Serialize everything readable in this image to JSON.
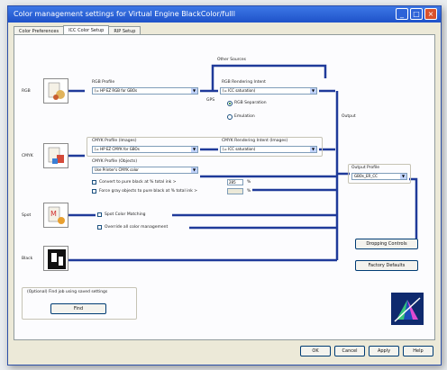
{
  "window": {
    "title": "Color management settings for Virtual Engine BlackColor/fulll",
    "buttons": {
      "minimize": "_",
      "maximize": "□",
      "close": "×"
    }
  },
  "tabs": [
    {
      "label": "Color Preferences"
    },
    {
      "label": "ICC Color Setup"
    },
    {
      "label": "RIP Setup"
    }
  ],
  "sections": {
    "rgb": {
      "label": "RGB"
    },
    "cmyk": {
      "label": "CMYK"
    },
    "spot": {
      "label": "Spot"
    },
    "black": {
      "label": "Black"
    }
  },
  "rgb": {
    "profile_label": "RGB Profile",
    "profile_value": "(= HP EZ RGB for GBOs",
    "other_sources_label": "Other Sources",
    "rendering_intent_label": "RGB Rendering Intent",
    "rendering_intent_value": "(= ICC saturation)",
    "separation_label": "RGB Separation",
    "emulation_label": "Emulation",
    "gps_label": "GPS"
  },
  "cmyk": {
    "profile_images_label": "CMYK Profile (Images)",
    "profile_images_value": "(= HP EZ CMYK for GBOs",
    "rendering_intent_images_label": "CMYK Rendering Intent (Images)",
    "rendering_intent_images_value": "(= ICC saturation)",
    "profile_objects_label": "CMYK Profile (Objects)",
    "profile_objects_value": "Use Printer's CMYK color",
    "convert_black_label": "Convert to pure black at % total ink >",
    "convert_black_value": "285",
    "convert_black_unit": "%",
    "force_gray_label": "Force gray objects to pure black at % total ink >",
    "force_gray_value": "",
    "force_gray_unit": "%"
  },
  "spot": {
    "spot_matching_label": "Spot Color Matching",
    "override_label": "Override all color management"
  },
  "output": {
    "output_label": "Output",
    "profile_label": "Output Profile",
    "profile_value": "GBOs_ER_CC"
  },
  "buttons": {
    "dropping_controls": "Dropping Controls",
    "factory_defaults": "Factory Defaults",
    "find": "Find",
    "ok": "OK",
    "cancel": "Cancel",
    "apply": "Apply",
    "help": "Help"
  },
  "saved_settings": {
    "label": "(Optional) Find job using saved settings"
  },
  "colors": {
    "accent_line": "#1f3a9a",
    "titlebar": "#2458d0"
  }
}
